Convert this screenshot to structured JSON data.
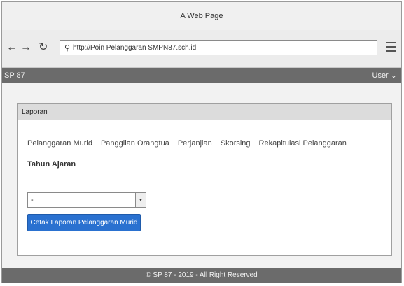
{
  "window": {
    "title": "A Web Page"
  },
  "browser": {
    "back_icon": "back-arrow-icon",
    "forward_icon": "forward-arrow-icon",
    "reload_icon": "reload-icon",
    "url": "http://Poin Pelanggaran SMPN87.sch.id"
  },
  "app": {
    "brand": "SP 87",
    "user_menu": "User ⌄"
  },
  "panel": {
    "title": "Laporan",
    "tabs": [
      "Pelanggaran Murid",
      "Panggilan Orangtua",
      "Perjanjian",
      "Skorsing",
      "Rekapitulasi Pelanggaran"
    ],
    "field_label": "Tahun Ajaran",
    "select_value": "-",
    "button_label": "Cetak Laporan Pelanggaran Murid"
  },
  "footer": {
    "text": "© SP 87 - 2019 - All Right Reserved"
  }
}
